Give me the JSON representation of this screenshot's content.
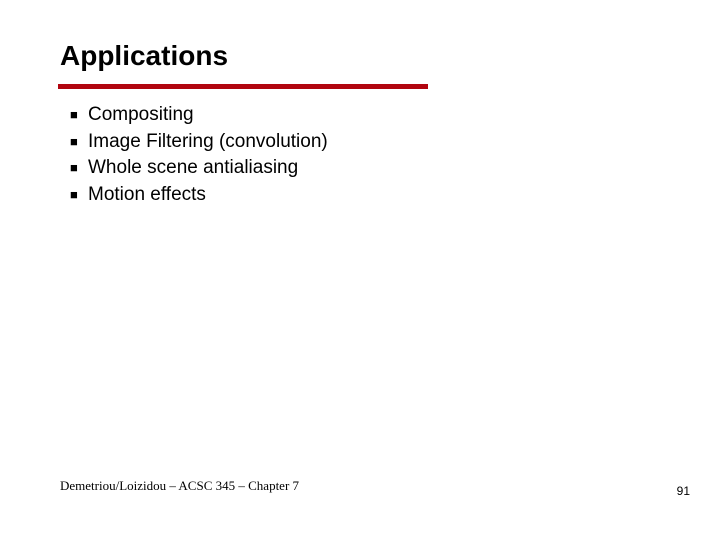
{
  "title": "Applications",
  "bullets": {
    "items": [
      "Compositing",
      "Image Filtering (convolution)",
      "Whole scene antialiasing",
      "Motion effects"
    ]
  },
  "footer": {
    "left": "Demetriou/Loizidou – ACSC 345 – Chapter 7",
    "right": "91"
  },
  "glyphs": {
    "bullet": "■"
  }
}
